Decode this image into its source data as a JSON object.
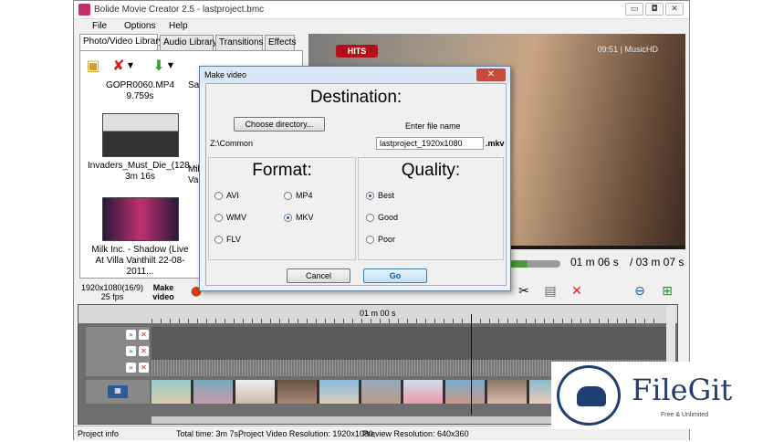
{
  "window": {
    "title": "Bolide Movie Creator 2.5 - lastproject.bmc",
    "buttons": [
      "▭",
      "◘",
      "✕"
    ]
  },
  "menu": [
    "File",
    "Options",
    "Help"
  ],
  "tabs": [
    "Photo/Video Library",
    "Audio Library",
    "Transitions",
    "Effects"
  ],
  "library": {
    "items": [
      {
        "name": "GOPR0060.MP4",
        "duration": "9.759s"
      },
      {
        "name": "Sa",
        "duration": ""
      },
      {
        "name": "Invaders_Must_Die_(128...",
        "duration": "3m 16s"
      },
      {
        "name": "Mill",
        "duration": "Vadi"
      },
      {
        "name": "Milk Inc. - Shadow (Live At Villa Vanthilt 22-08-2011...",
        "duration": ""
      }
    ]
  },
  "preview": {
    "badge": "HITS",
    "osd": "09:51 | MusicHD",
    "current_time": "01 m 06 s",
    "total_time": "/ 03 m 07 s",
    "progress": 0.35
  },
  "toolbar": {
    "resolution": "1920x1080(16/9)",
    "fps": "25 fps",
    "make_video": "Make video"
  },
  "timeline": {
    "ruler_label": "01 m 00 s"
  },
  "status": {
    "project_info": "Project info",
    "total_time": "Total time: 3m 7s,",
    "project_res": "Project Video Resolution:  1920x1080,",
    "preview_res": "Preview Resolution:   640x360"
  },
  "dialog": {
    "title": "Make video",
    "destination": {
      "heading": "Destination:",
      "choose_btn": "Choose directory...",
      "path": "Z:\\Common",
      "filename_label": "Enter file name",
      "filename": "lastproject_1920x1080",
      "extension": ".mkv"
    },
    "format": {
      "heading": "Format:",
      "options": [
        "AVI",
        "MP4",
        "WMV",
        "MKV",
        "FLV"
      ],
      "selected": "MKV"
    },
    "quality": {
      "heading": "Quality:",
      "options": [
        "Best",
        "Good",
        "Poor"
      ],
      "selected": "Best"
    },
    "cancel": "Cancel",
    "go": "Go"
  },
  "watermark": {
    "name": "FileGit",
    "tagline": "Free & Unlimited"
  }
}
